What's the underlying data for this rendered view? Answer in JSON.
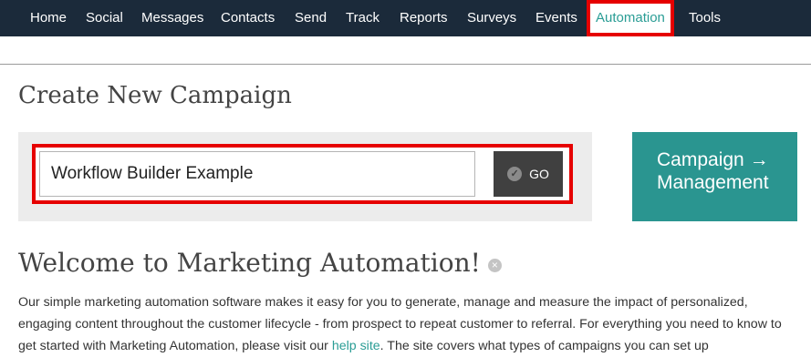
{
  "nav": {
    "items": [
      {
        "label": "Home"
      },
      {
        "label": "Social"
      },
      {
        "label": "Messages"
      },
      {
        "label": "Contacts"
      },
      {
        "label": "Send"
      },
      {
        "label": "Track"
      },
      {
        "label": "Reports"
      },
      {
        "label": "Surveys"
      },
      {
        "label": "Events"
      },
      {
        "label": "Automation",
        "active": true
      },
      {
        "label": "Tools"
      }
    ]
  },
  "page": {
    "title": "Create New Campaign"
  },
  "campaign_form": {
    "name_value": "Workflow Builder Example",
    "go_label": "GO"
  },
  "management_button": {
    "line1": "Campaign",
    "arrow": "→",
    "line2": "Management"
  },
  "welcome": {
    "title": "Welcome to Marketing Automation!",
    "paragraph_part1": "Our simple marketing automation software makes it easy for you to generate, manage and measure the impact of personalized, engaging content throughout the customer lifecycle - from prospect to repeat customer to referral. For everything you need to know to get started with Marketing Automation, please visit our ",
    "link_text": "help site",
    "paragraph_part2": ". The site covers what types of campaigns you can set up"
  },
  "colors": {
    "nav_background": "#1b2a3a",
    "accent_teal": "#2a9590",
    "highlight_red": "#e60000",
    "go_button": "#404040"
  },
  "icons": {
    "go": "check-circle-icon",
    "arrow": "arrow-right-icon",
    "dismiss": "close-circle-icon"
  }
}
